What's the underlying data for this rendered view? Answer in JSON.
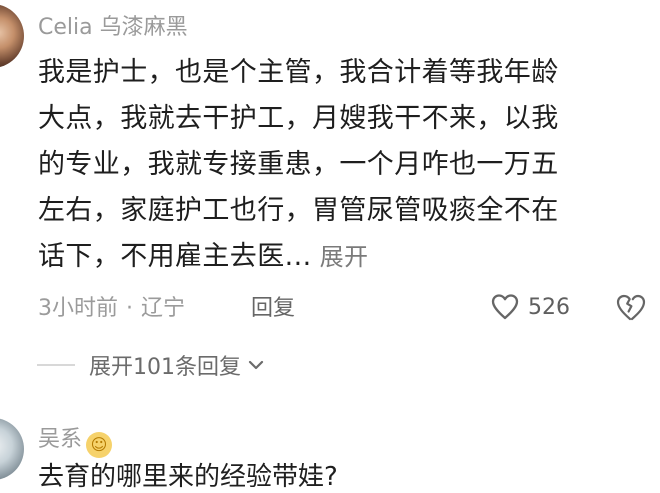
{
  "comments": [
    {
      "username": "Celia 乌漆麻黑",
      "lines": [
        "我是护士，也是个主管，我合计着等我年龄",
        "大点，我就去干护工，月嫂我干不来，以我",
        "的专业，我就专接重患，一个月咋也一万五",
        "左右，家庭护工也行，胃管尿管吸痰全不在",
        "话下，不用雇主去医..."
      ],
      "expand_label": "展开",
      "time": "3小时前",
      "location": "辽宁",
      "separator": "·",
      "reply_label": "回复",
      "likes": "526",
      "replies_toggle": "展开101条回复"
    },
    {
      "username": "吴系",
      "preview": "去育的哪里来的经验带娃?"
    }
  ],
  "icons": {
    "heart": "heart-icon",
    "dislike": "broken-heart-icon",
    "chevron": "chevron-down-icon",
    "emoji": "smiling-face-icon"
  },
  "colors": {
    "text": "#1e1e1e",
    "meta": "#9b9b9b",
    "accent": "#5f5f5f"
  }
}
